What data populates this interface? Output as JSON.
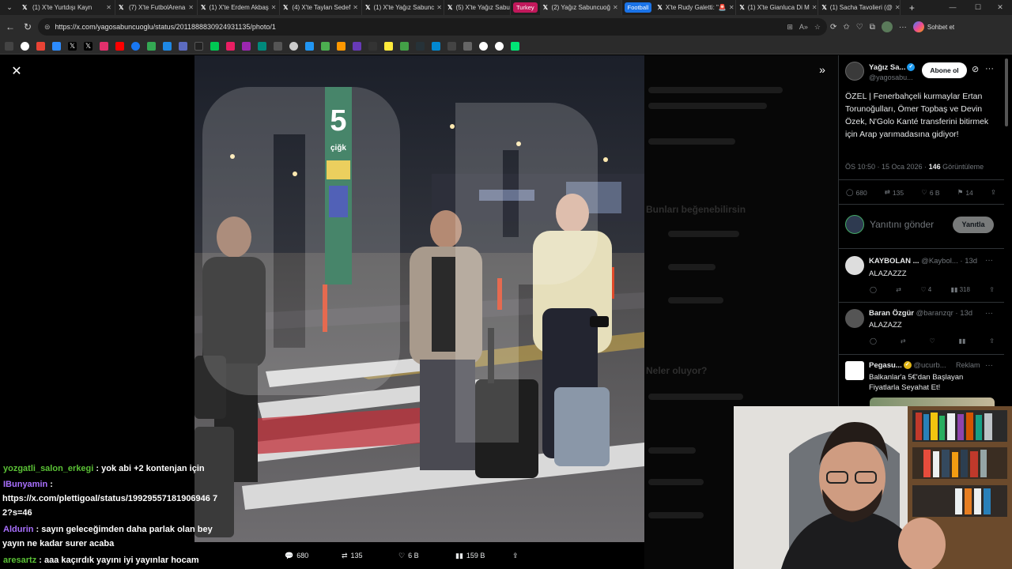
{
  "browser": {
    "tabs": [
      {
        "title": "(1) X'te Yurtdışı Kayn"
      },
      {
        "title": "(7) X'te FutbolArena"
      },
      {
        "title": "(1) X'te Erdem Akbaş"
      },
      {
        "title": "(4) X'te Taylan Sedef"
      },
      {
        "title": "(1) X'te Yağız Sabunc"
      },
      {
        "title": "(5) X'te Yağız Sabunc"
      },
      {
        "title": "(2) Yağız Sabuncuoğ"
      },
      {
        "title": "X'te Rudy Galetti: \"🚨"
      },
      {
        "title": "(1) X'te Gianluca Di M"
      },
      {
        "title": "(1) Sacha Tavolieri (@"
      }
    ],
    "groups": [
      {
        "label": "Turkey",
        "color": "#c2185b"
      },
      {
        "label": "Football",
        "color": "#1a73e8"
      }
    ],
    "url": "https://x.com/yagosabuncuoglu/status/2011888830924931135/photo/1",
    "copilot_label": "Sohbet et"
  },
  "post": {
    "author_name": "Yağız Sa...",
    "author_handle": "@yagosabu...",
    "follow_label": "Abone ol",
    "text": "ÖZEL | Fenerbahçeli kurmaylar Ertan Torunoğulları, Ömer Topbaş ve Devin Özek, N'Golo Kanté transferini bitirmek için Arap yarımadasına gidiyor!",
    "time": "ÖS 10:50 · 15 Oca 2026 · ",
    "views": "146",
    "views_label": " Görüntüleme",
    "replies": "680",
    "reposts": "135",
    "likes": "6 B",
    "bookmarks": "14",
    "reply_placeholder": "Yanıtını gönder",
    "reply_button": "Yanıtla"
  },
  "replies": [
    {
      "name": "KAYBOLAN ...",
      "handle": "@Kaybol... · 13d",
      "text": "ALAZAZZZ",
      "replies": "",
      "reposts": "",
      "likes": "4",
      "views": "318"
    },
    {
      "name": "Baran Özgür",
      "handle": "@baranzqr · 13d",
      "text": "ALAZAZZ",
      "replies": "",
      "reposts": "",
      "likes": "",
      "views": ""
    }
  ],
  "ad": {
    "name": "Pegasu...",
    "handle": "@ucurb...",
    "tag": "Reklam",
    "text": "Balkanlar'a 5€'dan Başlayan Fiyatlarla Seyahat Et!"
  },
  "photo_stats": {
    "replies": "680",
    "reposts": "135",
    "likes": "6 B",
    "views": "159 B"
  },
  "photo": {
    "sign": "5",
    "brand": "çiğk"
  },
  "chat": [
    {
      "user": "yozgatli_salon_erkegi",
      "sep": " : ",
      "msg": "yok abi +2 kontenjan için"
    },
    {
      "user": "IBunyamin",
      "sep": " :",
      "msg": ""
    },
    {
      "user": "",
      "sep": "",
      "msg": "https://x.com/plettigoal/status/19929557181906946 7"
    },
    {
      "user": "",
      "sep": "",
      "msg": "2?s=46"
    },
    {
      "user": "Aldurin",
      "sep": " : ",
      "msg": "sayın geleceğimden daha parlak olan bey"
    },
    {
      "user": "",
      "sep": "",
      "msg": "yayın ne kadar surer acaba"
    },
    {
      "user": "aresartz",
      "sep": " : ",
      "msg": "aaa kaçırdık yayını iyi yayınlar hocam"
    }
  ],
  "background": {
    "items": [
      "Bunları beğenebilirsin",
      "Neler oluyor?"
    ]
  }
}
